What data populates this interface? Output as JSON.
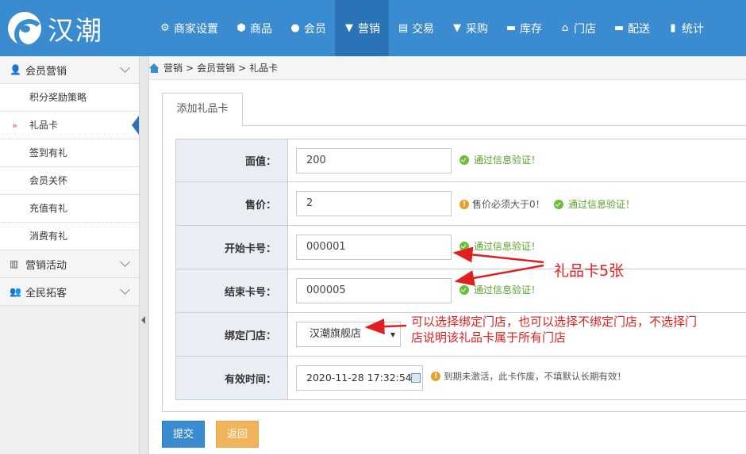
{
  "brand": {
    "name": "汉潮"
  },
  "nav": [
    {
      "icon": "gear-icon",
      "glyph": "⚙",
      "label": "商家设置",
      "active": false
    },
    {
      "icon": "cube-icon",
      "glyph": "⬢",
      "label": "商品",
      "active": false
    },
    {
      "icon": "user-icon",
      "glyph": "●",
      "label": "会员",
      "active": false
    },
    {
      "icon": "cup-icon",
      "glyph": "◆",
      "label": "营销",
      "active": true
    },
    {
      "icon": "clipboard-icon",
      "glyph": "▤",
      "label": "交易",
      "active": false
    },
    {
      "icon": "cart-icon",
      "glyph": "◆",
      "label": "采购",
      "active": false
    },
    {
      "icon": "warehouse-icon",
      "glyph": "▬",
      "label": "库存",
      "active": false
    },
    {
      "icon": "home-icon",
      "glyph": "⌂",
      "label": "门店",
      "active": false
    },
    {
      "icon": "truck-icon",
      "glyph": "▬",
      "label": "配送",
      "active": false
    },
    {
      "icon": "bar-chart-icon",
      "glyph": "▮",
      "label": "统计",
      "active": false
    }
  ],
  "sidebar": {
    "groups": [
      {
        "label": "会员营销",
        "icon": "member-icon",
        "items": [
          "积分奖励策略",
          "礼品卡",
          "签到有礼",
          "会员关怀",
          "充值有礼",
          "消费有礼"
        ],
        "active_item": 1
      },
      {
        "label": "营销活动",
        "icon": "gift-icon"
      },
      {
        "label": "全民拓客",
        "icon": "users-icon"
      }
    ]
  },
  "breadcrumb": [
    "营销",
    "会员营销",
    "礼品卡"
  ],
  "tab": {
    "label": "添加礼品卡"
  },
  "form": {
    "face_value": {
      "label": "面值：",
      "value": "200",
      "ok": "通过信息验证！"
    },
    "price": {
      "label": "售价：",
      "value": "2",
      "warn": "售价必须大于0！",
      "ok": "通过信息验证！"
    },
    "start_no": {
      "label": "开始卡号：",
      "value": "000001",
      "ok": "通过信息验证！"
    },
    "end_no": {
      "label": "结束卡号：",
      "value": "000005",
      "ok": "通过信息验证！"
    },
    "store": {
      "label": "绑定门店：",
      "value": "汉潮旗舰店"
    },
    "expire": {
      "label": "有效时间：",
      "value": "2020-11-28 17:32:54",
      "hint": "到期未激活，此卡作废，不填默认长期有效！"
    }
  },
  "buttons": {
    "submit": "提交",
    "back": "返回"
  },
  "annotations": {
    "count": "礼品卡5张",
    "store_line1": "可以选择绑定门店，也可以选择不绑定门店，不选择门",
    "store_line2": "店说明该礼品卡属于所有门店",
    "color": "#e02020"
  }
}
